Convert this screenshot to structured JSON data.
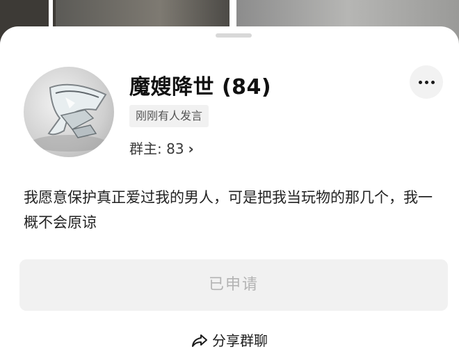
{
  "group": {
    "name": "魔嫂降世 (84)",
    "activity_tag": "刚刚有人发言",
    "owner_label": "群主: 83",
    "owner_chevron": "›",
    "description": "我愿意保护真正爱过我的男人，可是把我当玩物的那几个，我一概不会原谅"
  },
  "actions": {
    "applied_label": "已申请",
    "share_label": "分享群聊"
  },
  "icons": {
    "more": "more-dots-icon",
    "share": "share-arrow-icon",
    "avatar": "glass-vase-image"
  }
}
